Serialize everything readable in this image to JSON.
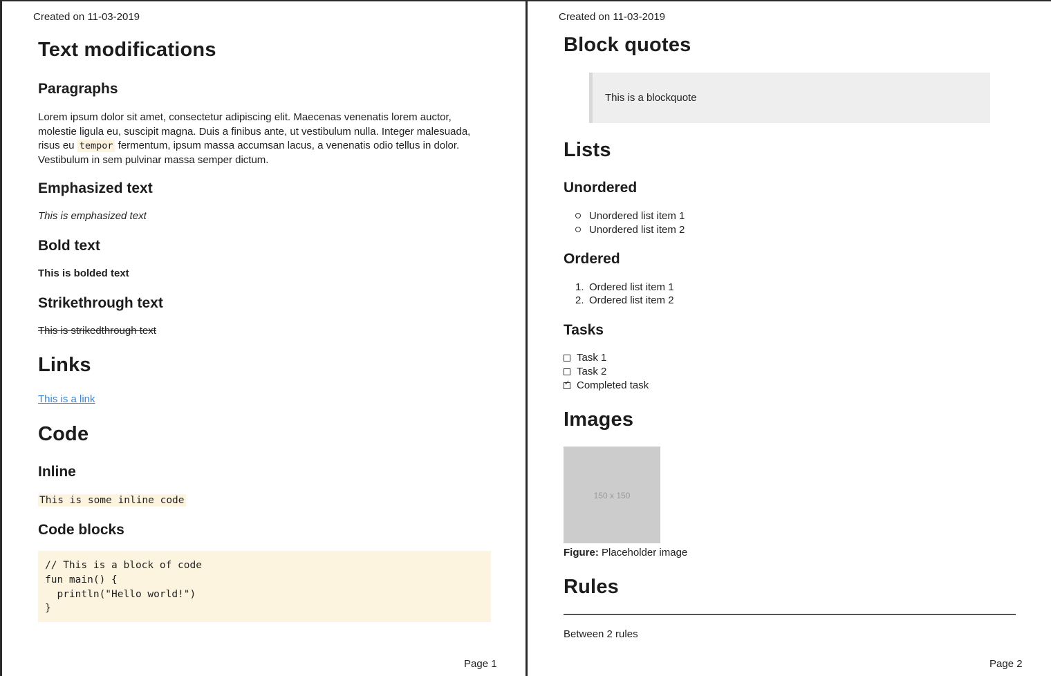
{
  "pages": [
    {
      "created": "Created on 11-03-2019",
      "page_label": "Page 1",
      "text_modifications": {
        "title": "Text modifications",
        "paragraphs": {
          "heading": "Paragraphs",
          "text_before_code": "Lorem ipsum dolor sit amet, consectetur adipiscing elit. Maecenas venenatis lorem auctor, molestie ligula eu, suscipit magna. Duis a finibus ante, ut vestibulum nulla. Integer malesuada, risus eu ",
          "inline_code": "tempor",
          "text_after_code": " fermentum, ipsum massa accumsan lacus, a venenatis odio tellus in dolor. Vestibulum in sem pulvinar massa semper dictum."
        },
        "emphasized": {
          "heading": "Emphasized text",
          "text": "This is emphasized text"
        },
        "bold": {
          "heading": "Bold text",
          "text": "This is bolded text"
        },
        "strikethrough": {
          "heading": "Strikethrough text",
          "text": "This is strikedthrough text"
        }
      },
      "links": {
        "title": "Links",
        "link_text": "This is a link"
      },
      "code": {
        "title": "Code",
        "inline": {
          "heading": "Inline",
          "code": "This is some inline code"
        },
        "blocks": {
          "heading": "Code blocks",
          "lines": [
            "// This is a block of code",
            "fun main() {",
            "  println(\"Hello world!\")",
            "}"
          ]
        }
      }
    },
    {
      "created": "Created on 11-03-2019",
      "page_label": "Page 2",
      "block_quotes": {
        "title": "Block quotes",
        "quote": "This is a blockquote"
      },
      "lists": {
        "title": "Lists",
        "unordered": {
          "heading": "Unordered",
          "items": [
            "Unordered list item 1",
            "Unordered list item 2"
          ]
        },
        "ordered": {
          "heading": "Ordered",
          "items": [
            "Ordered list item 1",
            "Ordered list item 2"
          ],
          "markers": [
            "1.",
            "2."
          ]
        },
        "tasks": {
          "heading": "Tasks",
          "items": [
            {
              "label": "Task 1",
              "checked": false
            },
            {
              "label": "Task 2",
              "checked": false
            },
            {
              "label": "Completed task",
              "checked": true
            }
          ]
        }
      },
      "images": {
        "title": "Images",
        "placeholder_text": "150 x 150",
        "caption_label": "Figure:",
        "caption_text": "Placeholder image"
      },
      "rules": {
        "title": "Rules",
        "text": "Between 2 rules"
      }
    }
  ],
  "colors": {
    "link": "#3b86d8",
    "code_background": "#fdf4e0",
    "blockquote_background": "#eeeeee",
    "image_placeholder": "#cccccc"
  },
  "icons": [
    "circle-bullet-icon",
    "checkbox-icon",
    "checkbox-checked-icon"
  ]
}
